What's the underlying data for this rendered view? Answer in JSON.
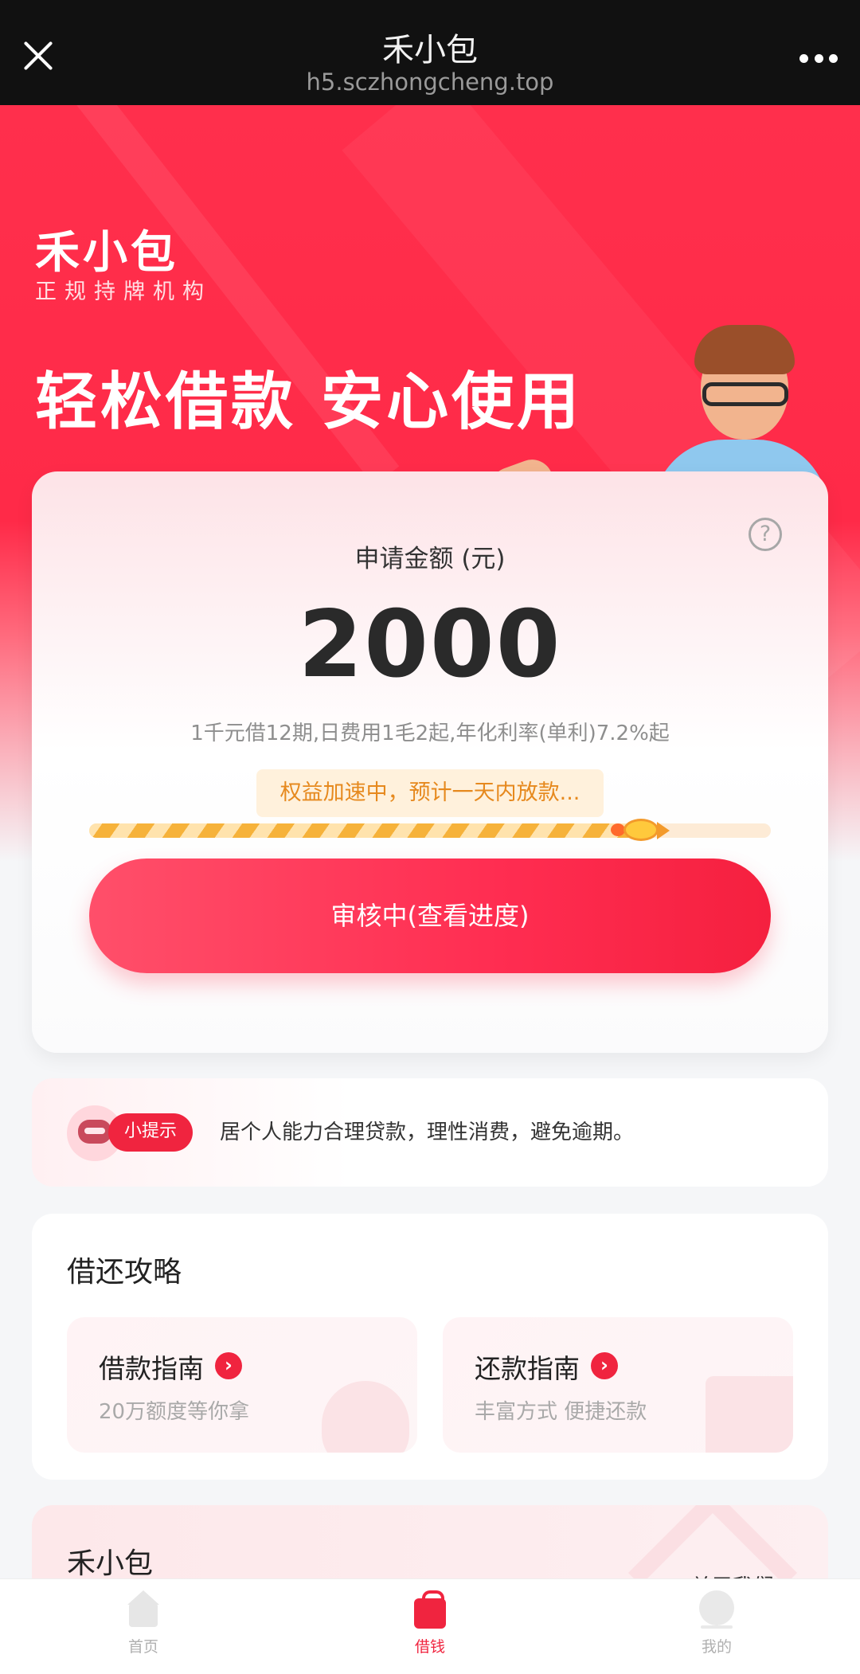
{
  "topbar": {
    "title": "禾小包",
    "domain": "h5.sczhongcheng.top",
    "close_icon": "close-icon",
    "more_icon": "more-icon"
  },
  "hero": {
    "brand": "禾小包",
    "brand_sub": "正规持牌机构",
    "slogan": "轻松借款  安心使用"
  },
  "loan_card": {
    "label": "申请金额 (元)",
    "amount": "2000",
    "note": "1千元借12期,日费用1毛2起,年化利率(单利)7.2%起",
    "progress_text": "权益加速中，预计一天内放款...",
    "progress_fraction": 0.8,
    "cta_label": "审核中(查看进度)",
    "help_symbol": "?"
  },
  "tips": {
    "tag": "小提示",
    "message": "居个人能力合理贷款，理性消费，避免逾期。"
  },
  "guides": {
    "title": "借还攻略",
    "items": [
      {
        "title": "借款指南",
        "subtitle": "20万额度等你拿",
        "arrow": "›"
      },
      {
        "title": "还款指南",
        "subtitle": "丰富方式 便捷还款",
        "arrow": "›"
      }
    ]
  },
  "about": {
    "title": "禾小包",
    "link": "关于我们 ▶"
  },
  "tabbar": {
    "items": [
      {
        "label": "首页",
        "icon": "home-icon",
        "active": false
      },
      {
        "label": "借钱",
        "icon": "bag-icon",
        "active": true
      },
      {
        "label": "我的",
        "icon": "user-icon",
        "active": false
      }
    ]
  },
  "colors": {
    "primary": "#f0243f",
    "hero_red": "#ff2f4c",
    "progress_orange": "#e6891e"
  }
}
